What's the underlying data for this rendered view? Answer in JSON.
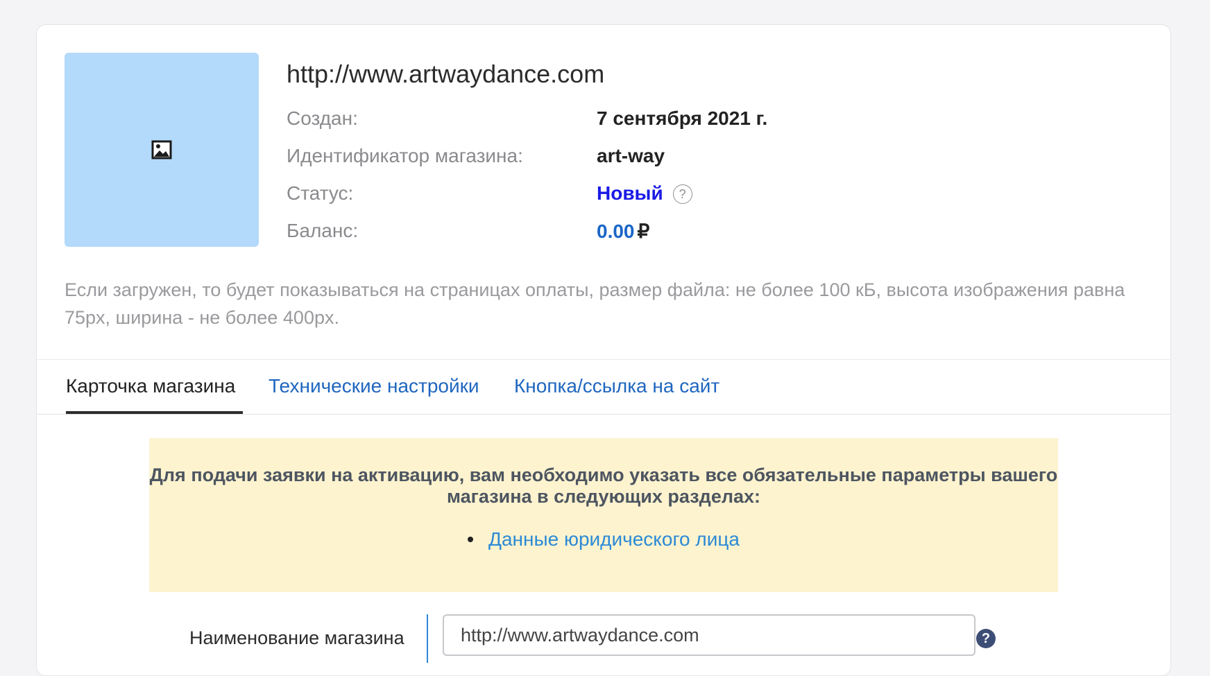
{
  "shop": {
    "url": "http://www.artwaydance.com",
    "logo_icon": "image-placeholder-icon"
  },
  "info": {
    "created_label": "Создан:",
    "created_value": "7 сентября 2021 г.",
    "id_label": "Идентификатор магазина:",
    "id_value": "art-way",
    "status_label": "Статус:",
    "status_value": "Новый",
    "status_help": "?",
    "balance_label": "Баланс:",
    "balance_value": "0.00",
    "balance_currency": "₽"
  },
  "hint": "Если загружен, то будет показываться на страницах оплаты, размер файла: не более 100 кБ, высота изображения равна 75px, ширина - не более 400px.",
  "tabs": [
    {
      "label": "Карточка магазина",
      "active": true
    },
    {
      "label": "Технические настройки",
      "active": false
    },
    {
      "label": "Кнопка/ссылка на сайт",
      "active": false
    }
  ],
  "alert": {
    "text": "Для подачи заявки на активацию, вам необходимо указать все обязательные параметры вашего магазина в следующих разделах:",
    "items": [
      "Данные юридического лица"
    ]
  },
  "form": {
    "shop_name_label": "Наименование магазина",
    "shop_name_value": "http://www.artwaydance.com",
    "help": "?"
  },
  "colors": {
    "accent_link": "#1f66bf",
    "status_new": "#1a1ae6",
    "alert_bg": "#fdf3cf",
    "logo_bg": "#b3d9fb"
  }
}
